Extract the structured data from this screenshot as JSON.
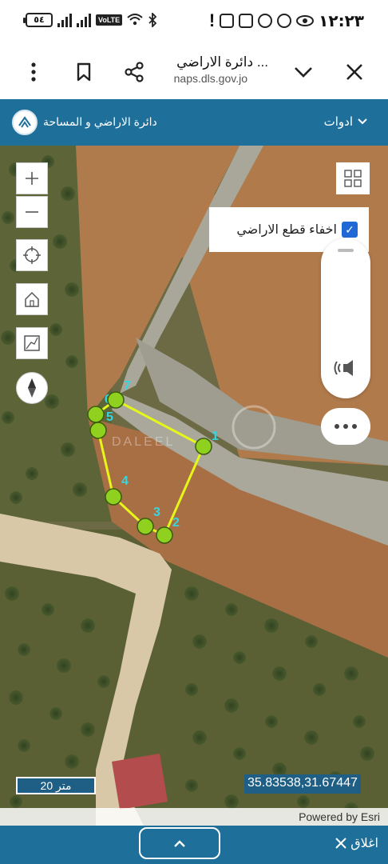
{
  "status_bar": {
    "battery": "٥٤",
    "network_label": "VoLTE",
    "clock": "١٢:٢٣"
  },
  "browser": {
    "page_title": "دائرة الاراضي ...",
    "url": "naps.dls.gov.jo"
  },
  "app_header": {
    "org_name": "دائرة الاراضي و المساحة",
    "tools_menu": "ادوات"
  },
  "map": {
    "hide_parcels_label": "اخفاء قطع الاراضي",
    "hide_parcels_checked": true,
    "watermark": "DALEEL",
    "scale_label": "20 متر",
    "coordinates": "35.83538,31.67447",
    "attribution": "Powered by Esri",
    "vertices": [
      {
        "label": "1"
      },
      {
        "label": "2"
      },
      {
        "label": "3"
      },
      {
        "label": "4"
      },
      {
        "label": "5"
      },
      {
        "label": "6"
      },
      {
        "label": "7"
      }
    ],
    "colors": {
      "parcel_line": "#e6f51a",
      "vertex_fill": "#8fd11e",
      "vertex_label": "#35d6e0"
    }
  },
  "bottom_bar": {
    "close_label": "اغلاق"
  }
}
